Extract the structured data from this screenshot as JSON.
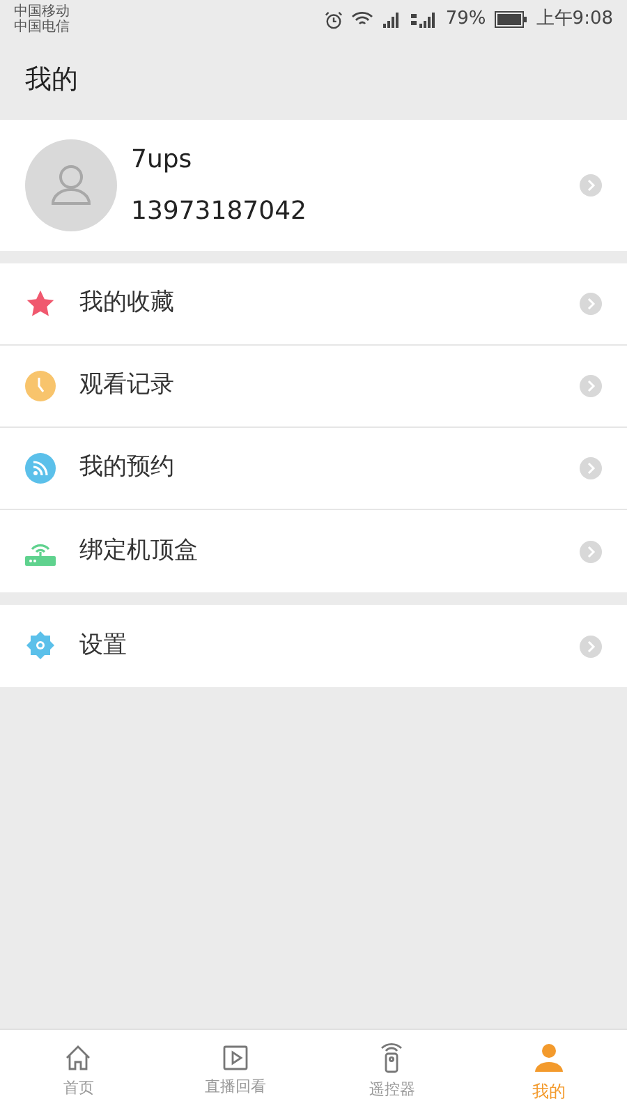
{
  "status_bar": {
    "carriers": [
      "中国移动",
      "中国电信"
    ],
    "battery": "79%",
    "time": "上午9:08"
  },
  "header": {
    "title": "我的"
  },
  "profile": {
    "name": "7ups",
    "phone": "13973187042"
  },
  "menu_groups": [
    {
      "items": [
        {
          "kind": "star",
          "label": "我的收藏"
        },
        {
          "kind": "clock",
          "label": "观看记录"
        },
        {
          "kind": "feed",
          "label": "我的预约"
        },
        {
          "kind": "router",
          "label": "绑定机顶盒"
        }
      ]
    },
    {
      "items": [
        {
          "kind": "gear",
          "label": "设置"
        }
      ]
    }
  ],
  "tab_bar": [
    {
      "kind": "home",
      "label": "首页",
      "selected": false
    },
    {
      "kind": "play",
      "label": "直播回看",
      "selected": false
    },
    {
      "kind": "remote",
      "label": "遥控器",
      "selected": false
    },
    {
      "kind": "person",
      "label": "我的",
      "selected": true
    }
  ]
}
